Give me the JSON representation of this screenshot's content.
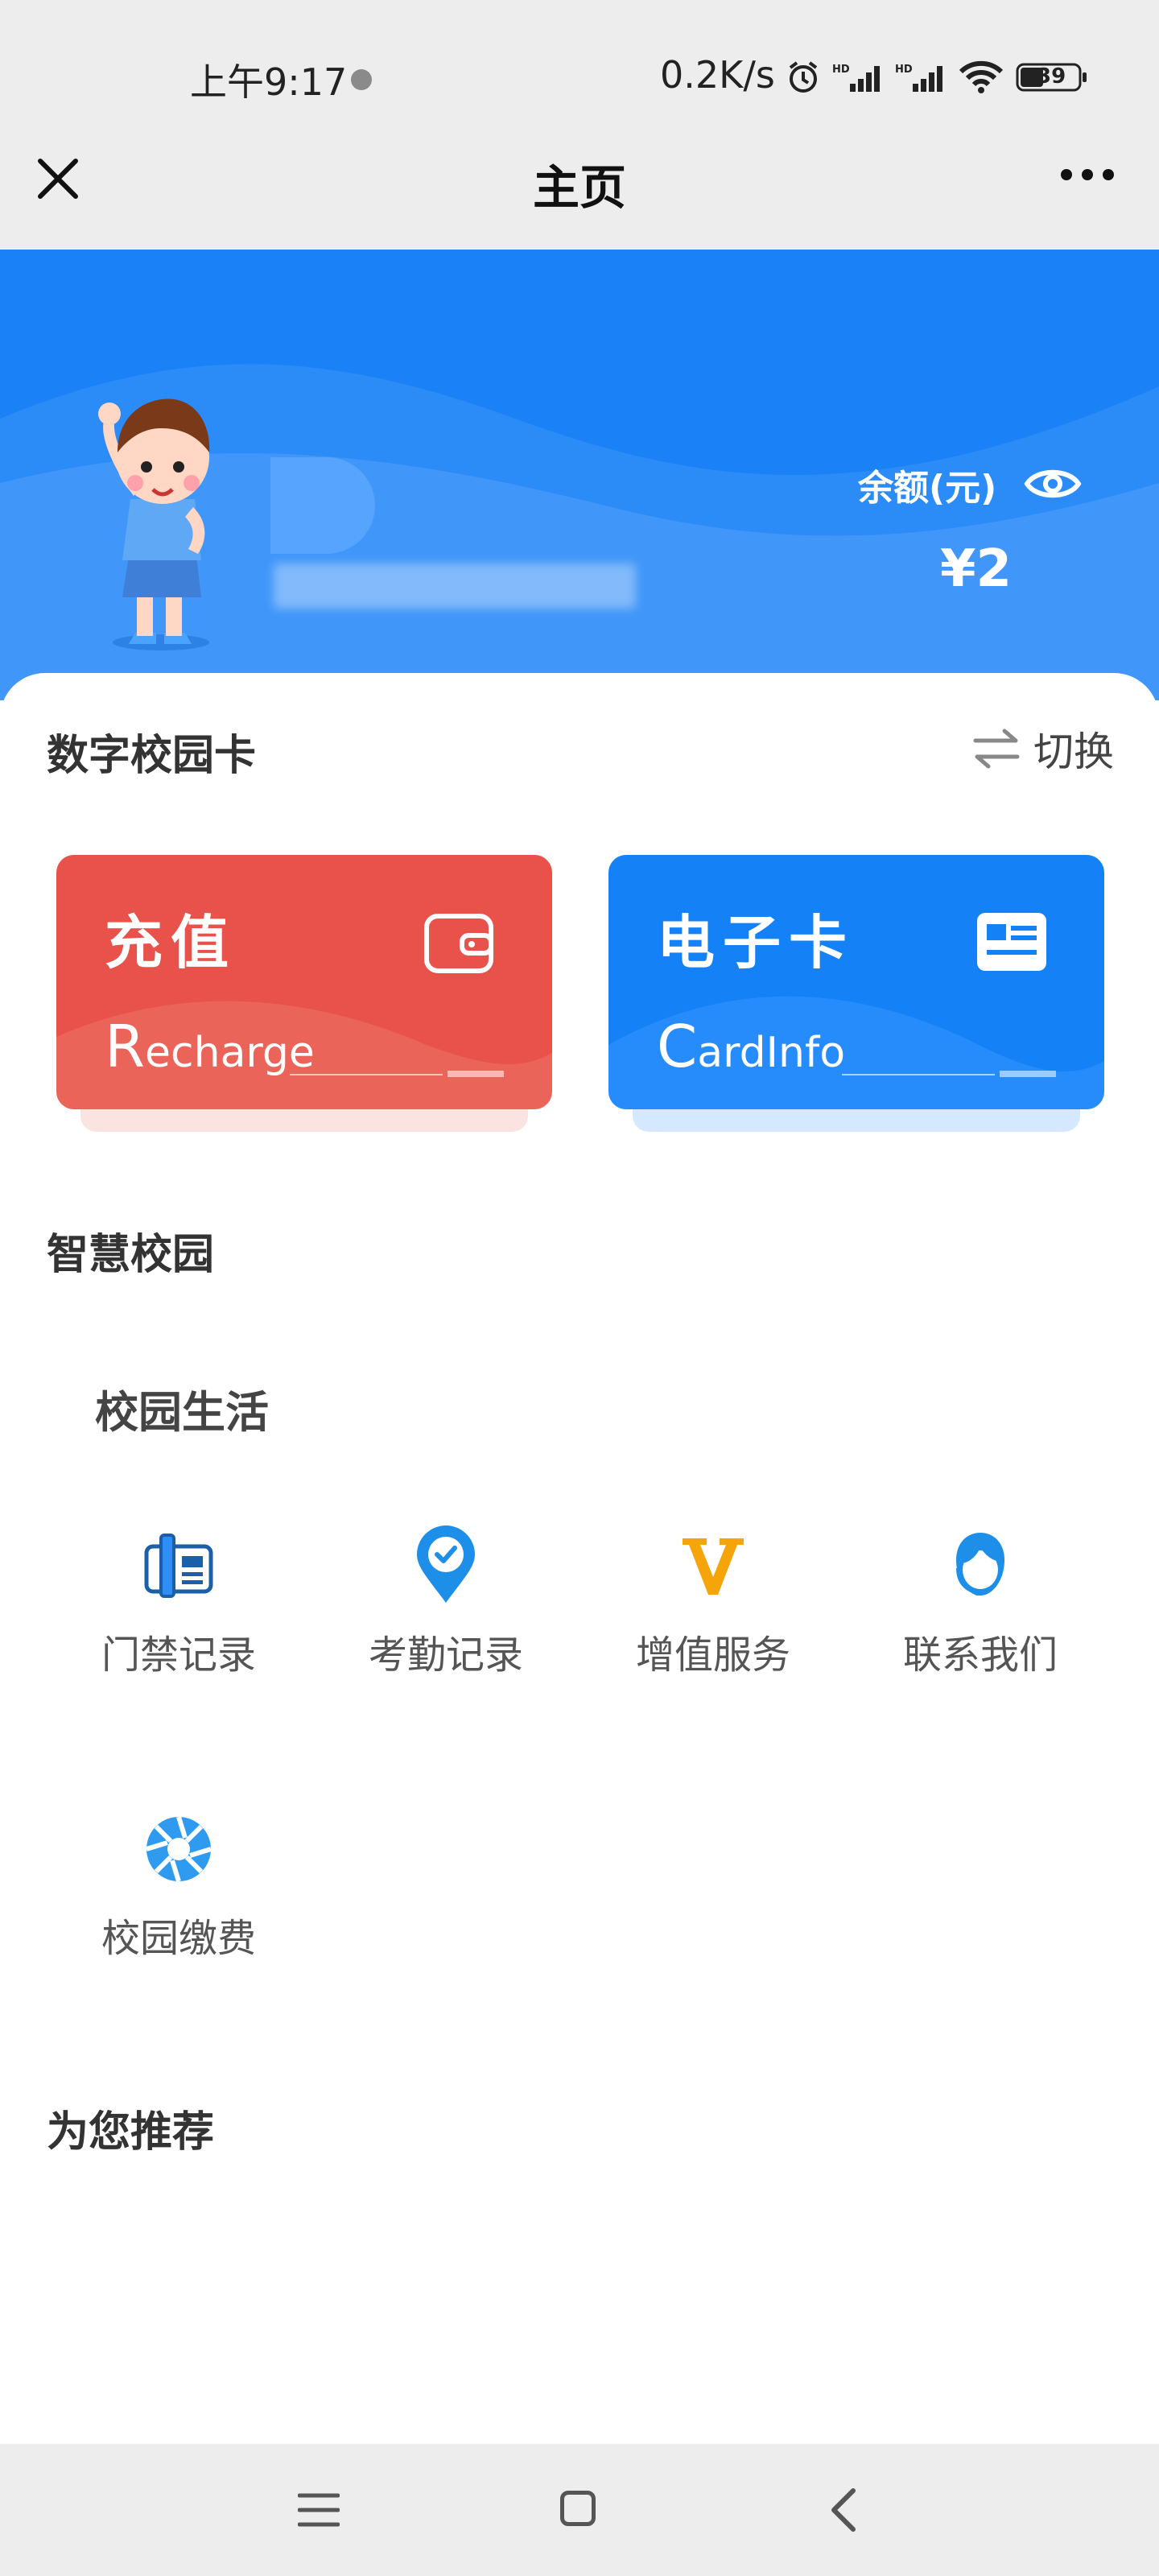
{
  "status_bar": {
    "time": "上午9:17",
    "speed": "0.2K/s",
    "battery": "39"
  },
  "title_bar": {
    "title": "主页"
  },
  "hero": {
    "school_name": "",
    "balance_label": "余额(元)",
    "balance_value": "¥2"
  },
  "digital_card": {
    "section_title": "数字校园卡",
    "switch_label": "切换",
    "recharge": {
      "title": "充值",
      "subtitle_initial": "R",
      "subtitle_rest": "echarge"
    },
    "ecard": {
      "title": "电子卡",
      "subtitle_initial": "C",
      "subtitle_rest": "ardInfo"
    }
  },
  "smart_campus": {
    "section_title": "智慧校园",
    "group_title": "校园生活",
    "items": [
      {
        "label": "门禁记录",
        "icon": "access-card-icon"
      },
      {
        "label": "考勤记录",
        "icon": "attendance-pin-icon"
      },
      {
        "label": "增值服务",
        "icon": "v-service-icon"
      },
      {
        "label": "联系我们",
        "icon": "customer-service-icon"
      },
      {
        "label": "校园缴费",
        "icon": "payment-shutter-icon"
      }
    ]
  },
  "recommend": {
    "section_title": "为您推荐"
  },
  "colors": {
    "hero_blue": "#1a82f6",
    "recharge_red": "#e8524a",
    "ecard_blue": "#1482f6",
    "accent_orange": "#f5a50a"
  }
}
